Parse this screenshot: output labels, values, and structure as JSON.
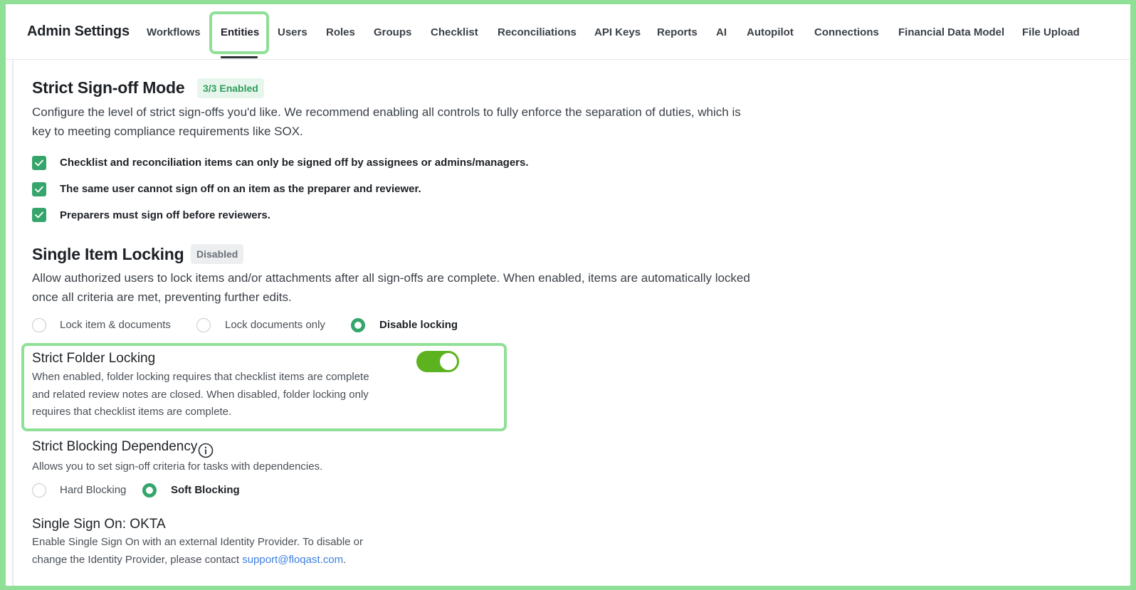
{
  "header": {
    "title": "Admin Settings",
    "tabs": [
      {
        "label": "Workflows"
      },
      {
        "label": "Entities",
        "active": true
      },
      {
        "label": "Users"
      },
      {
        "label": "Roles"
      },
      {
        "label": "Groups"
      },
      {
        "label": "Checklist"
      },
      {
        "label": "Reconciliations"
      },
      {
        "label": "API Keys"
      },
      {
        "label": "Reports"
      },
      {
        "label": "AI"
      },
      {
        "label": "Autopilot"
      },
      {
        "label": "Connections"
      },
      {
        "label": "Financial Data Model"
      },
      {
        "label": "File Upload"
      }
    ]
  },
  "strict_signoff": {
    "title": "Strict Sign-off Mode",
    "badge": "3/3 Enabled",
    "description_line1": "Configure the level of strict sign-offs you'd like. We recommend enabling all controls to fully enforce the separation of duties, which is",
    "description_line2": "key to meeting compliance requirements like SOX.",
    "options": [
      {
        "label": "Checklist and reconciliation items can only be signed off by assignees or admins/managers.",
        "checked": true
      },
      {
        "label": "The same user cannot sign off on an item as the preparer and reviewer.",
        "checked": true
      },
      {
        "label": "Preparers must sign off before reviewers.",
        "checked": true
      }
    ]
  },
  "single_item_locking": {
    "title": "Single Item Locking",
    "badge": "Disabled",
    "description_line1": "Allow authorized users to lock items and/or attachments after all sign-offs are complete. When enabled, items are automatically locked",
    "description_line2": "once all criteria are met, preventing further edits.",
    "options": [
      {
        "label": "Lock item & documents",
        "selected": false
      },
      {
        "label": "Lock documents only",
        "selected": false
      },
      {
        "label": "Disable locking",
        "selected": true
      }
    ]
  },
  "strict_folder_locking": {
    "title": "Strict Folder Locking",
    "description_line1": "When enabled, folder locking requires that checklist items are complete",
    "description_line2": "and related review notes are closed. When disabled, folder locking only",
    "description_line3": "requires that checklist items are complete.",
    "enabled": true
  },
  "strict_blocking": {
    "title": "Strict Blocking Dependency",
    "description": "Allows you to set sign-off criteria for tasks with dependencies.",
    "options": [
      {
        "label": "Hard Blocking",
        "selected": false
      },
      {
        "label": "Soft Blocking",
        "selected": true
      }
    ]
  },
  "sso": {
    "title": "Single Sign On: OKTA",
    "description_line1": "Enable Single Sign On with an external Identity Provider. To disable or",
    "description_line2_prefix": "change the Identity Provider, please contact ",
    "support_link": "support@floqast.com",
    "description_line2_suffix": "."
  },
  "colors": {
    "accent_green": "#36a56b",
    "toggle_on": "#5cb31f",
    "highlight": "#8fe096",
    "link": "#3d7ee0"
  }
}
